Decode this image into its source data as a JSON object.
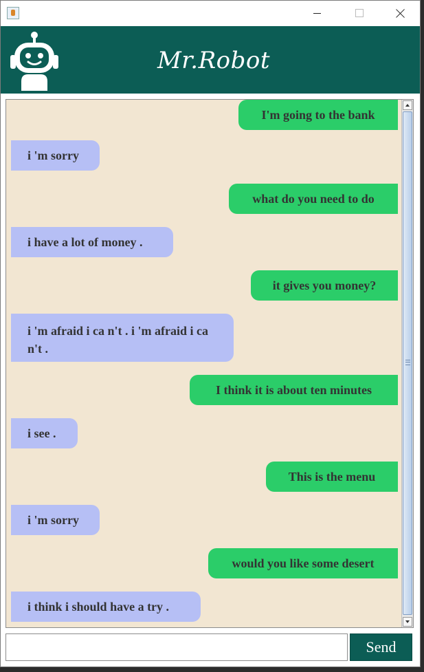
{
  "window": {
    "title": ""
  },
  "header": {
    "title": "Mr.Robot",
    "logo_icon": "robot-icon",
    "color": "#0c5d55"
  },
  "chat": {
    "messages": [
      {
        "sender": "user",
        "text": "I'm going to the bank"
      },
      {
        "sender": "bot",
        "text": "i 'm sorry"
      },
      {
        "sender": "user",
        "text": "what do you need to do"
      },
      {
        "sender": "bot",
        "text": "i have a lot of money ."
      },
      {
        "sender": "user",
        "text": "it gives you money?"
      },
      {
        "sender": "bot",
        "text": "i 'm afraid i ca n't . i 'm afraid i ca n't ."
      },
      {
        "sender": "user",
        "text": "I think it is about ten minutes"
      },
      {
        "sender": "bot",
        "text": "i see ."
      },
      {
        "sender": "user",
        "text": "This is the menu"
      },
      {
        "sender": "bot",
        "text": "i 'm sorry"
      },
      {
        "sender": "user",
        "text": "would you like some desert"
      },
      {
        "sender": "bot",
        "text": "i think i should have a try ."
      }
    ],
    "colors": {
      "user_bubble": "#2bcd69",
      "bot_bubble": "#b6bff5",
      "background": "#f2e6d2"
    }
  },
  "input": {
    "value": "",
    "placeholder": ""
  },
  "send_button": {
    "label": "Send"
  }
}
